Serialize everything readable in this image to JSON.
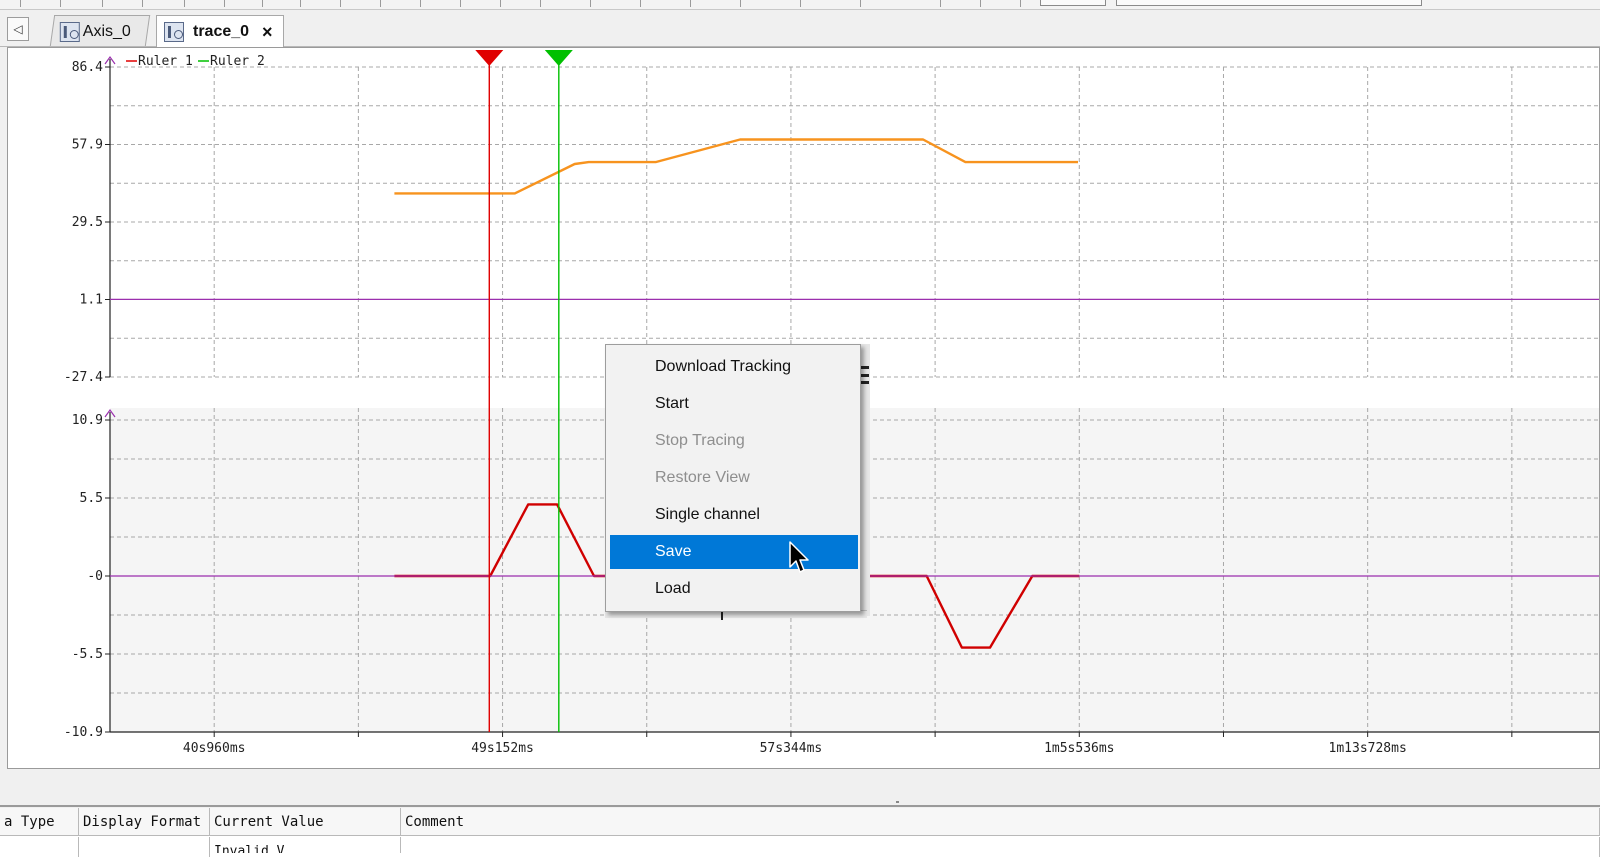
{
  "tabs": [
    {
      "label": "Axis_0",
      "icon": "axis-config-icon",
      "active": false
    },
    {
      "label": "trace_0",
      "icon": "trace-scope-icon",
      "active": true
    }
  ],
  "tab_close_glyph": "×",
  "tab_scroll_glyph": "◁",
  "chart_data": [
    {
      "type": "line",
      "panel": "upper",
      "y_ticks": [
        "86.4",
        "57.9",
        "29.5",
        "1.1",
        "-27.4"
      ],
      "ylim": [
        -27.4,
        86.4
      ],
      "x_ticks": [
        "40s960ms",
        "49s152ms",
        "57s344ms",
        "1m5s536ms",
        "1m13s728ms"
      ],
      "x_tick_values_ms": [
        40960,
        49152,
        57344,
        65536,
        73728
      ],
      "xlim_ms": [
        38000,
        80300
      ],
      "legend": [
        {
          "name": "Ruler 1",
          "color": "#e00000"
        },
        {
          "name": "Ruler 2",
          "color": "#00c000"
        }
      ],
      "legend_position": "top-left",
      "grid": true,
      "series": [
        {
          "color": "#f7931e",
          "x_ms": [
            49152,
            49500,
            51200,
            51600,
            53500,
            55900,
            61100,
            62300,
            65500
          ],
          "values": [
            40.0,
            40.0,
            50.8,
            51.5,
            51.5,
            59.8,
            59.8,
            51.5,
            51.5
          ],
          "x_start_ms": 46080
        },
        {
          "color": "#9b2fae",
          "x_ms": [
            38000,
            80300
          ],
          "values": [
            1.1,
            1.1
          ]
        }
      ],
      "rulers": [
        {
          "name": "Ruler 1",
          "x_ms": 48775,
          "color": "#e00000"
        },
        {
          "name": "Ruler 2",
          "x_ms": 50750,
          "color": "#00c000"
        }
      ]
    },
    {
      "type": "line",
      "panel": "lower",
      "y_ticks": [
        "10.9",
        "5.5",
        "-0",
        "-5.5",
        "-10.9"
      ],
      "ylim": [
        -10.9,
        10.9
      ],
      "x_ticks": [
        "40s960ms",
        "49s152ms",
        "57s344ms",
        "1m5s536ms",
        "1m13s728ms"
      ],
      "x_tick_values_ms": [
        40960,
        49152,
        57344,
        65536,
        73728
      ],
      "xlim_ms": [
        38000,
        80300
      ],
      "grid": true,
      "series": [
        {
          "color": "#d00000",
          "x_ms": [
            46080,
            48800,
            49880,
            50700,
            51750,
            52500,
            61200,
            62200,
            63000,
            64200,
            65536
          ],
          "values": [
            0,
            0,
            5.0,
            5.0,
            0,
            0,
            0,
            -5.0,
            -5.0,
            0,
            0
          ]
        },
        {
          "color": "#9b2fae",
          "x_ms": [
            38000,
            80300
          ],
          "values": [
            0,
            0
          ]
        }
      ]
    }
  ],
  "context_menu": {
    "items": [
      {
        "label": "Download Tracking",
        "enabled": true,
        "selected": false
      },
      {
        "label": "Start",
        "enabled": true,
        "selected": false
      },
      {
        "label": "Stop Tracing",
        "enabled": false,
        "selected": false
      },
      {
        "label": "Restore View",
        "enabled": false,
        "selected": false
      },
      {
        "label": "Single channel",
        "enabled": true,
        "selected": false
      },
      {
        "label": "Save",
        "enabled": true,
        "selected": true
      },
      {
        "label": "Load",
        "enabled": true,
        "selected": false
      }
    ],
    "selected_color": "#0078d7"
  },
  "variable_table": {
    "columns": [
      "a Type",
      "Display Format",
      "Current Value",
      "Comment"
    ],
    "first_row_partial": [
      "",
      "",
      "Invalid V",
      ""
    ]
  }
}
